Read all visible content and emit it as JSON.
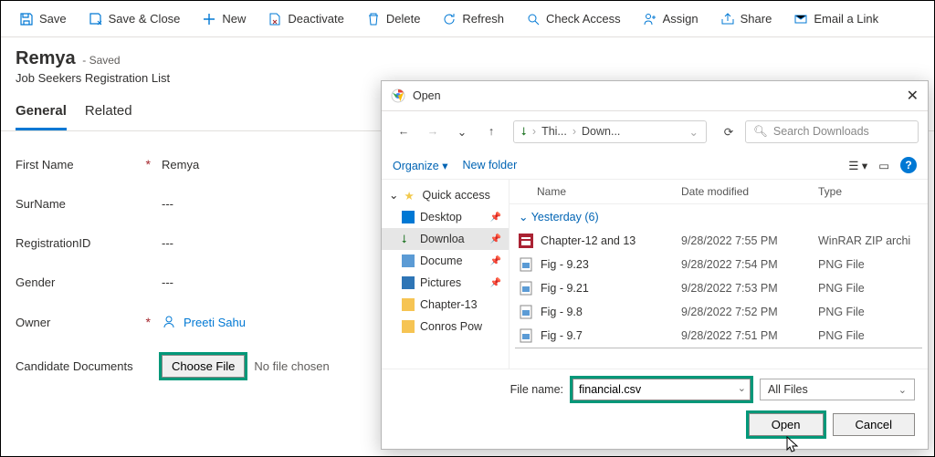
{
  "toolbar": {
    "save": "Save",
    "save_close": "Save & Close",
    "new": "New",
    "deactivate": "Deactivate",
    "delete": "Delete",
    "refresh": "Refresh",
    "check_access": "Check Access",
    "assign": "Assign",
    "share": "Share",
    "email_link": "Email a Link"
  },
  "header": {
    "title": "Remya",
    "saved": "- Saved",
    "subtitle": "Job Seekers Registration List"
  },
  "tabs": {
    "general": "General",
    "related": "Related"
  },
  "form": {
    "first_name_label": "First Name",
    "first_name_value": "Remya",
    "surname_label": "SurName",
    "surname_value": "---",
    "regid_label": "RegistrationID",
    "regid_value": "---",
    "gender_label": "Gender",
    "gender_value": "---",
    "owner_label": "Owner",
    "owner_value": "Preeti Sahu",
    "docs_label": "Candidate Documents",
    "choose_file": "Choose File",
    "no_file": "No file chosen"
  },
  "dialog": {
    "title": "Open",
    "breadcrumb": {
      "root": "Thi...",
      "leaf": "Down..."
    },
    "search_placeholder": "Search Downloads",
    "organize": "Organize",
    "new_folder": "New folder",
    "tree": {
      "quick": "Quick access",
      "desktop": "Desktop",
      "downloads": "Downloa",
      "documents": "Docume",
      "pictures": "Pictures",
      "chapter13": "Chapter-13",
      "conros": "Conros Pow"
    },
    "cols": {
      "name": "Name",
      "date": "Date modified",
      "type": "Type"
    },
    "group": "Yesterday (6)",
    "files": [
      {
        "name": "Chapter-12 and 13",
        "date": "9/28/2022 7:55 PM",
        "type": "WinRAR ZIP archi"
      },
      {
        "name": "Fig - 9.23",
        "date": "9/28/2022 7:54 PM",
        "type": "PNG File"
      },
      {
        "name": "Fig - 9.21",
        "date": "9/28/2022 7:53 PM",
        "type": "PNG File"
      },
      {
        "name": "Fig - 9.8",
        "date": "9/28/2022 7:52 PM",
        "type": "PNG File"
      },
      {
        "name": "Fig - 9.7",
        "date": "9/28/2022 7:51 PM",
        "type": "PNG File"
      }
    ],
    "filename_label": "File name:",
    "filename_value": "financial.csv",
    "filter": "All Files",
    "open_btn": "Open",
    "cancel_btn": "Cancel"
  }
}
